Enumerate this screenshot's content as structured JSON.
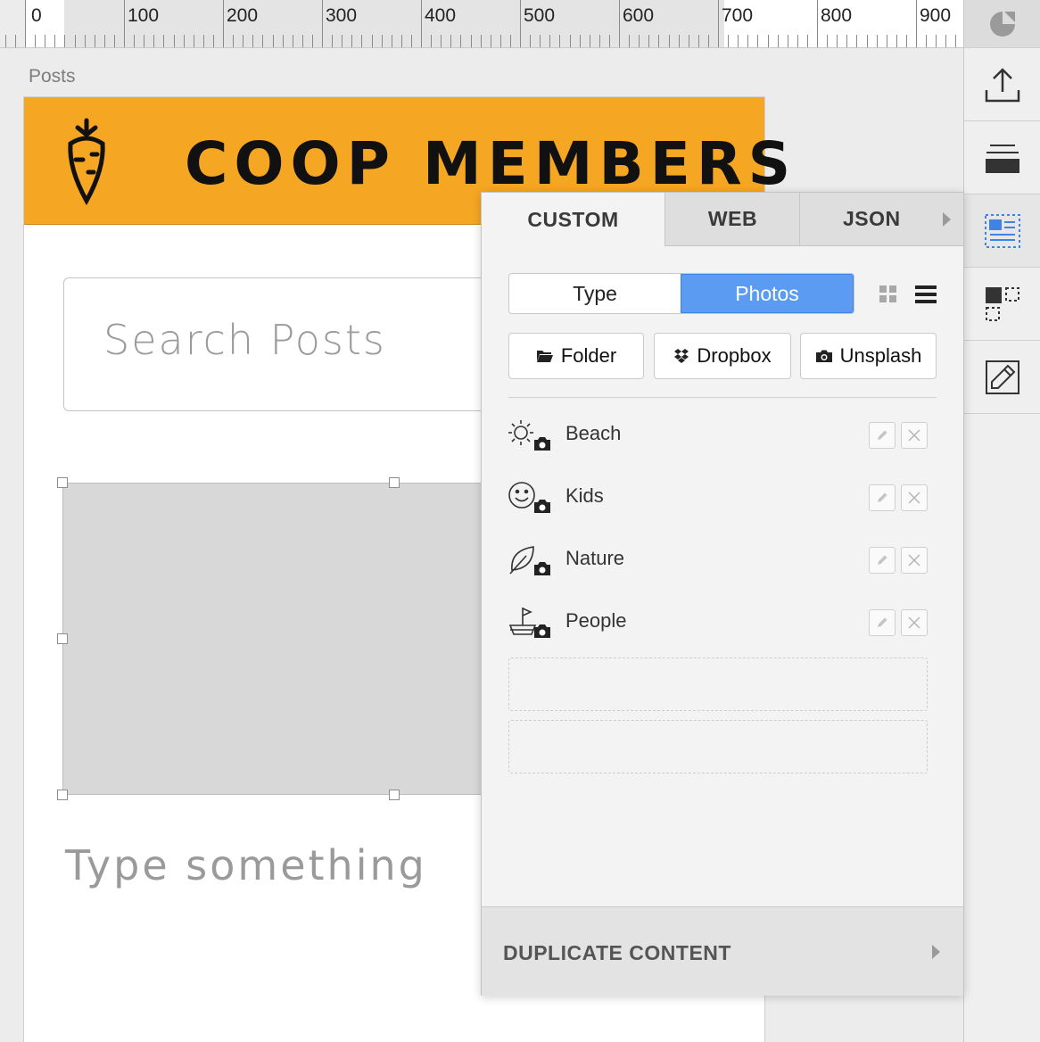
{
  "ruler": {
    "labels": [
      "0",
      "100",
      "200",
      "300",
      "400",
      "500",
      "600",
      "700",
      "800",
      "900"
    ]
  },
  "artboard": {
    "name": "Posts",
    "hero_title": "COOP MEMBERS",
    "search_placeholder": "Search Posts",
    "text_placeholder": "Type something"
  },
  "panel": {
    "tabs": [
      {
        "label": "CUSTOM",
        "active": true
      },
      {
        "label": "WEB",
        "active": false
      },
      {
        "label": "JSON",
        "active": false
      }
    ],
    "segmented": {
      "type_label": "Type",
      "photos_label": "Photos",
      "selected": "Photos"
    },
    "sources": [
      {
        "label": "Folder",
        "icon": "folder-icon"
      },
      {
        "label": "Dropbox",
        "icon": "dropbox-icon"
      },
      {
        "label": "Unsplash",
        "icon": "camera-icon"
      }
    ],
    "collections": [
      {
        "label": "Beach",
        "icon": "sun-camera-icon"
      },
      {
        "label": "Kids",
        "icon": "smiley-camera-icon"
      },
      {
        "label": "Nature",
        "icon": "leaf-camera-icon"
      },
      {
        "label": "People",
        "icon": "boat-camera-icon"
      }
    ],
    "footer_label": "DUPLICATE CONTENT"
  },
  "toolbar": {
    "items": [
      "logo-icon",
      "export-icon",
      "repeat-grid-icon",
      "content-icon",
      "layout-icon",
      "edit-symbol-icon"
    ]
  },
  "colors": {
    "hero_bg": "#f5a623",
    "accent": "#5b9cf2"
  }
}
